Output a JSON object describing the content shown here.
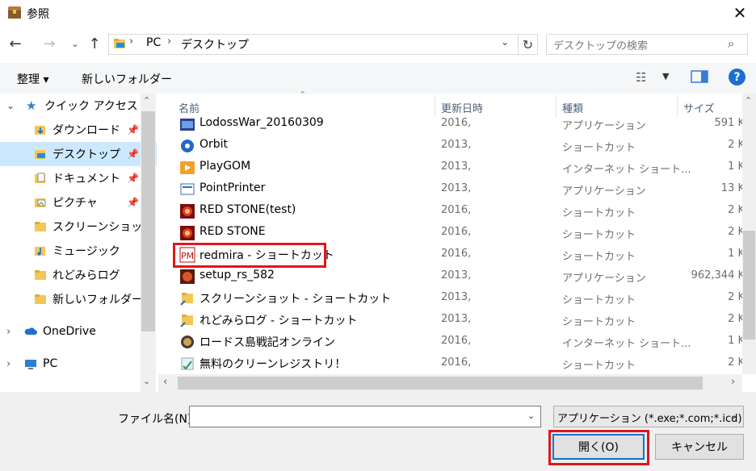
{
  "window": {
    "title": "参照"
  },
  "nav": {
    "breadcrumb": [
      "PC",
      "デスクトップ"
    ],
    "search_placeholder": "デスクトップの検索"
  },
  "toolbar": {
    "organize": "整理 ▾",
    "new_folder": "新しいフォルダー"
  },
  "sidebar": {
    "items": [
      {
        "label": "クイック アクセス",
        "icon": "star-icon",
        "pinned": false
      },
      {
        "label": "ダウンロード",
        "icon": "download-folder-icon",
        "pinned": true
      },
      {
        "label": "デスクトップ",
        "icon": "desktop-folder-icon",
        "pinned": true,
        "selected": true
      },
      {
        "label": "ドキュメント",
        "icon": "document-folder-icon",
        "pinned": true
      },
      {
        "label": "ピクチャ",
        "icon": "picture-folder-icon",
        "pinned": true
      },
      {
        "label": "スクリーンショット",
        "icon": "folder-icon",
        "pinned": false
      },
      {
        "label": "ミュージック",
        "icon": "music-folder-icon",
        "pinned": false
      },
      {
        "label": "れどみらログ",
        "icon": "folder-icon",
        "pinned": false
      },
      {
        "label": "新しいフォルダー",
        "icon": "folder-icon",
        "pinned": false
      },
      {
        "label": "OneDrive",
        "icon": "onedrive-icon",
        "pinned": false
      },
      {
        "label": "PC",
        "icon": "pc-icon",
        "pinned": false
      }
    ]
  },
  "columns": {
    "name": "名前",
    "date": "更新日時",
    "type": "種類",
    "size": "サイズ"
  },
  "files": [
    {
      "name": "LodossWar_20160309",
      "date": "2016,",
      "type": "アプリケーション",
      "size": "591 K",
      "icon": "app-icon"
    },
    {
      "name": "Orbit",
      "date": "2013,",
      "type": "ショートカット",
      "size": "2 K",
      "icon": "orbit-icon"
    },
    {
      "name": "PlayGOM",
      "date": "2013,",
      "type": "インターネット ショート...",
      "size": "1 K",
      "icon": "gom-icon"
    },
    {
      "name": "PointPrinter",
      "date": "2013,",
      "type": "アプリケーション",
      "size": "13 K",
      "icon": "printer-app-icon"
    },
    {
      "name": "RED STONE(test)",
      "date": "2016,",
      "type": "ショートカット",
      "size": "2 K",
      "icon": "redstone-icon"
    },
    {
      "name": "RED STONE",
      "date": "2016,",
      "type": "ショートカット",
      "size": "2 K",
      "icon": "redstone-icon"
    },
    {
      "name": "redmira - ショートカット",
      "date": "2016,",
      "type": "ショートカット",
      "size": "1 K",
      "icon": "redmira-icon"
    },
    {
      "name": "setup_rs_582",
      "date": "2013,",
      "type": "アプリケーション",
      "size": "962,344 K",
      "icon": "setup-icon"
    },
    {
      "name": "スクリーンショット - ショートカット",
      "date": "2013,",
      "type": "ショートカット",
      "size": "2 K",
      "icon": "folder-shortcut-icon"
    },
    {
      "name": "れどみらログ - ショートカット",
      "date": "2013,",
      "type": "ショートカット",
      "size": "2 K",
      "icon": "folder-shortcut-icon"
    },
    {
      "name": "ロードス島戦記オンライン",
      "date": "2016,",
      "type": "インターネット ショート...",
      "size": "1 K",
      "icon": "lodoss-icon"
    },
    {
      "name": "無料のクリーンレジストリ！",
      "date": "2016,",
      "type": "ショートカット",
      "size": "2 K",
      "icon": "registry-icon"
    }
  ],
  "bottom": {
    "filename_label": "ファイル名(N):",
    "filename_value": "",
    "filter": "アプリケーション (*.exe;*.com;*.icd)",
    "open": "開く(O)",
    "cancel": "キャンセル"
  },
  "colors": {
    "highlight": "#e0161b",
    "selection": "#cce8ff",
    "accent": "#0078d7"
  }
}
